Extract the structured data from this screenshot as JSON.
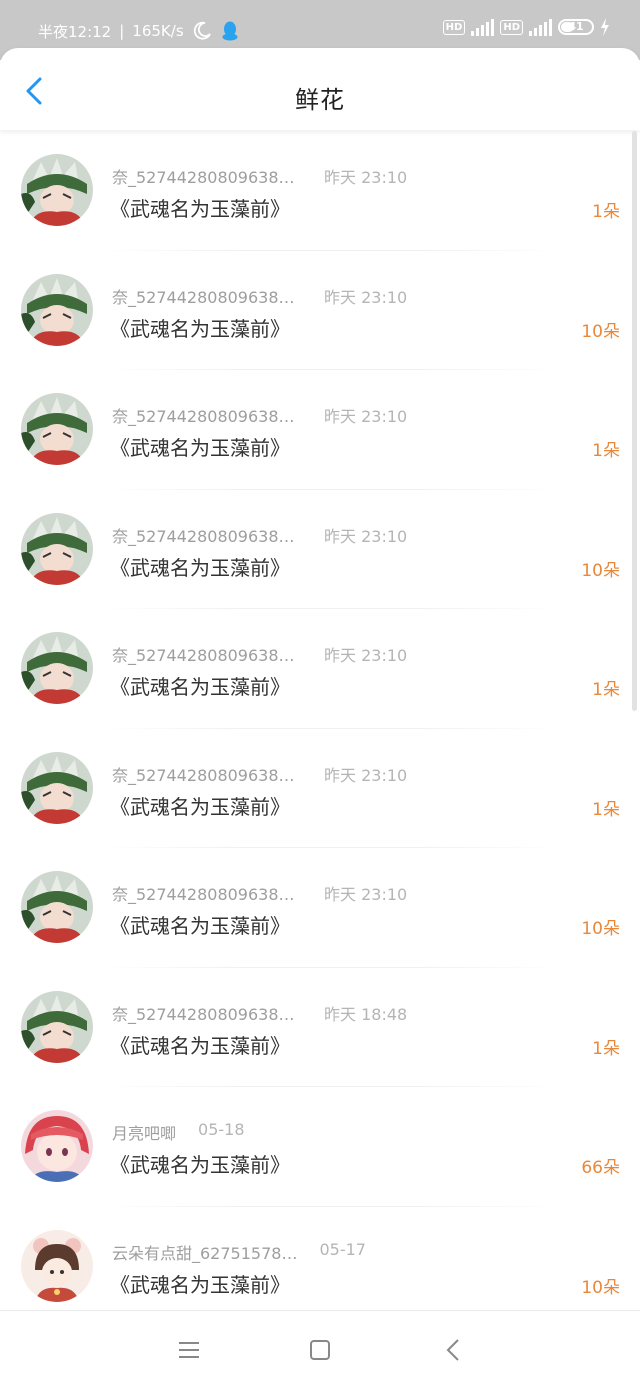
{
  "status_bar": {
    "time": "半夜12:12",
    "divider": "|",
    "speed": "165K/s",
    "battery": "41",
    "hd1": "HD",
    "hd2": "HD"
  },
  "header": {
    "title": "鲜花"
  },
  "items": [
    {
      "name": "奈_527442808096384…",
      "time": "昨天  23:10",
      "book": "《武魂名为玉藻前》",
      "count": "1朵",
      "avatar": "avatar-green"
    },
    {
      "name": "奈_527442808096384…",
      "time": "昨天  23:10",
      "book": "《武魂名为玉藻前》",
      "count": "10朵",
      "avatar": "avatar-green"
    },
    {
      "name": "奈_527442808096384…",
      "time": "昨天  23:10",
      "book": "《武魂名为玉藻前》",
      "count": "1朵",
      "avatar": "avatar-green"
    },
    {
      "name": "奈_527442808096384…",
      "time": "昨天  23:10",
      "book": "《武魂名为玉藻前》",
      "count": "10朵",
      "avatar": "avatar-green"
    },
    {
      "name": "奈_527442808096384…",
      "time": "昨天  23:10",
      "book": "《武魂名为玉藻前》",
      "count": "1朵",
      "avatar": "avatar-green"
    },
    {
      "name": "奈_527442808096384…",
      "time": "昨天  23:10",
      "book": "《武魂名为玉藻前》",
      "count": "1朵",
      "avatar": "avatar-green"
    },
    {
      "name": "奈_527442808096384…",
      "time": "昨天  23:10",
      "book": "《武魂名为玉藻前》",
      "count": "10朵",
      "avatar": "avatar-green"
    },
    {
      "name": "奈_527442808096384…",
      "time": "昨天  18:48",
      "book": "《武魂名为玉藻前》",
      "count": "1朵",
      "avatar": "avatar-green"
    },
    {
      "name": "月亮吧唧",
      "time": "05-18",
      "book": "《武魂名为玉藻前》",
      "count": "66朵",
      "avatar": "avatar-pink"
    },
    {
      "name": "云朵有点甜_62751578…",
      "time": "05-17",
      "book": "《武魂名为玉藻前》",
      "count": "10朵",
      "avatar": "avatar-cream"
    }
  ],
  "colors": {
    "accent": "#e8883a",
    "back_icon": "#2196f3",
    "status_bg": "#c8c8c8"
  },
  "system_nav": {
    "icons": [
      "menu-icon",
      "home-square-icon",
      "back-triangle-icon"
    ]
  }
}
